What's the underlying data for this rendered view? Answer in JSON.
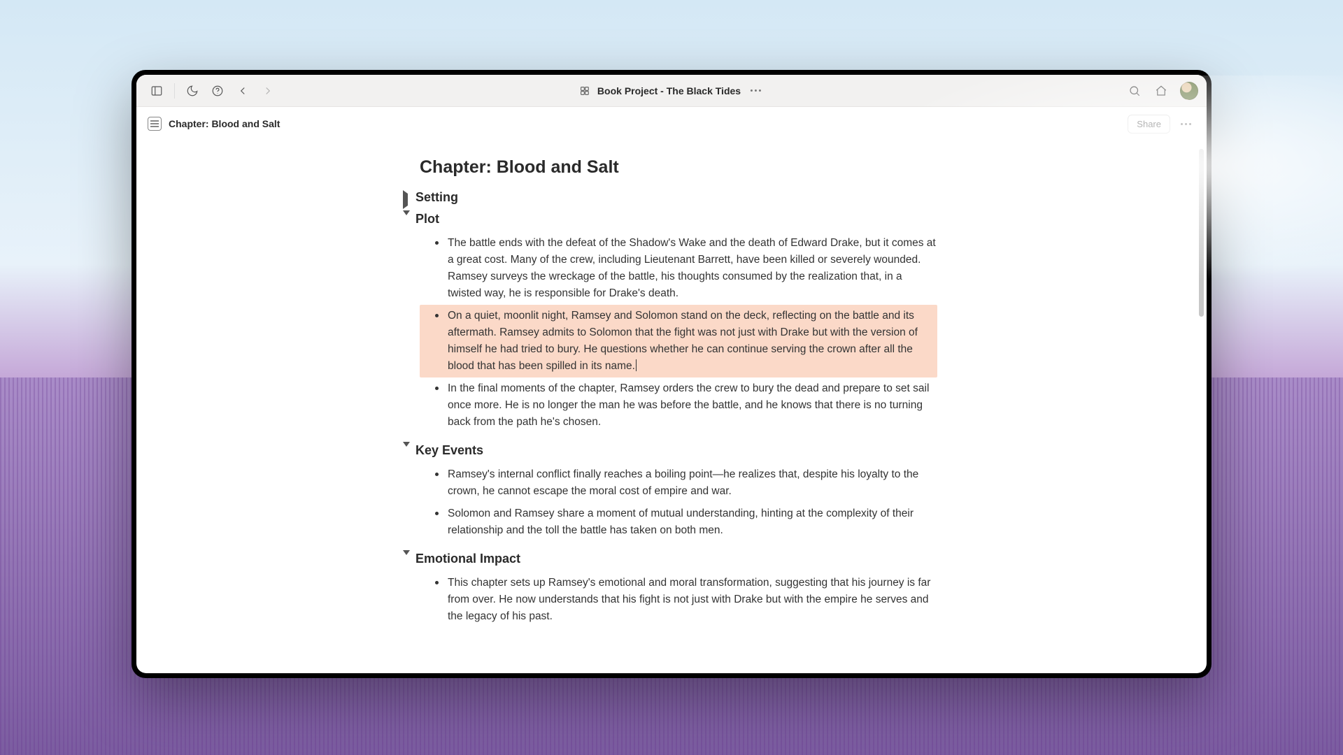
{
  "titlebar": {
    "project_title": "Book Project - The Black Tides"
  },
  "subheader": {
    "breadcrumb": "Chapter: Blood and Salt",
    "share_label": "Share"
  },
  "document": {
    "title": "Chapter: Blood and Salt",
    "sections": [
      {
        "heading": "Setting",
        "expanded": false,
        "items": []
      },
      {
        "heading": "Plot",
        "expanded": true,
        "items": [
          {
            "text": "The battle ends with the defeat of the Shadow's Wake and the death of Edward Drake, but it comes at a great cost. Many of the crew, including Lieutenant Barrett, have been killed or severely wounded. Ramsey surveys the wreckage of the battle, his thoughts consumed by the realization that, in a twisted way, he is responsible for Drake's death.",
            "highlighted": false
          },
          {
            "text": "On a quiet, moonlit night, Ramsey and Solomon stand on the deck, reflecting on the battle and its aftermath. Ramsey admits to Solomon that the fight was not just with Drake but with the version of himself he had tried to bury. He questions whether he can continue serving the crown after all the blood that has been spilled in its name.",
            "highlighted": true
          },
          {
            "text": "In the final moments of the chapter, Ramsey orders the crew to bury the dead and prepare to set sail once more. He is no longer the man he was before the battle, and he knows that there is no turning back from the path he's chosen.",
            "highlighted": false
          }
        ]
      },
      {
        "heading": "Key Events",
        "expanded": true,
        "items": [
          {
            "text": "Ramsey's internal conflict finally reaches a boiling point—he realizes that, despite his loyalty to the crown, he cannot escape the moral cost of empire and war.",
            "highlighted": false
          },
          {
            "text": "Solomon and Ramsey share a moment of mutual understanding, hinting at the complexity of their relationship and the toll the battle has taken on both men.",
            "highlighted": false
          }
        ]
      },
      {
        "heading": "Emotional Impact",
        "expanded": true,
        "items": [
          {
            "text": "This chapter sets up Ramsey's emotional and moral transformation, suggesting that his journey is far from over. He now understands that his fight is not just with Drake but with the empire he serves and the legacy of his past.",
            "highlighted": false
          }
        ]
      }
    ]
  }
}
